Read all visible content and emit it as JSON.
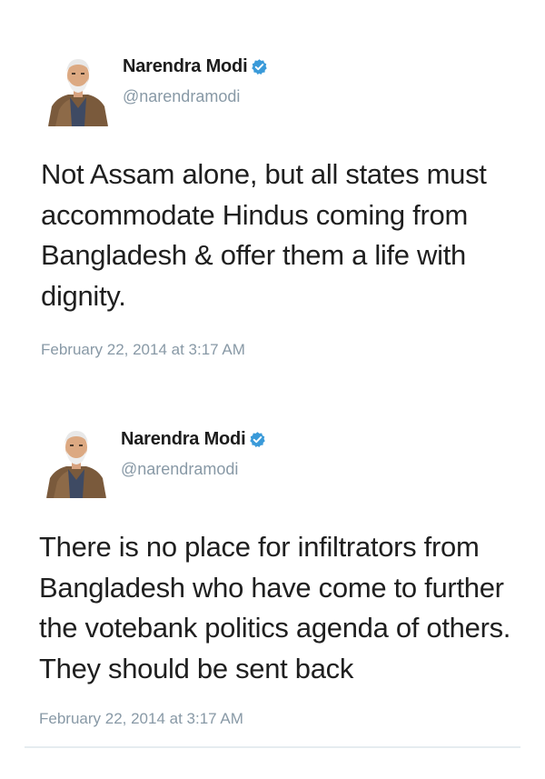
{
  "tweets": [
    {
      "display_name": "Narendra Modi",
      "handle": "@narendramodi",
      "verified": true,
      "text": "Not Assam alone, but all states must accommodate Hindus coming from Bangladesh & offer them a life with dignity.",
      "timestamp": "February 22, 2014 at 3:17 AM"
    },
    {
      "display_name": "Narendra Modi",
      "handle": "@narendramodi",
      "verified": true,
      "text": "There is no place for infiltrators from Bangladesh who have come to further the votebank politics agenda of others. They should be sent back",
      "timestamp": "February 22, 2014 at 3:17 AM"
    }
  ],
  "colors": {
    "verified_badge": "#3a9ad9",
    "secondary_text": "#8899a6",
    "primary_text": "#1f1f1f",
    "divider": "#e6ecf0"
  },
  "icons": {
    "avatar": "profile-photo",
    "verified": "verified-badge-icon"
  }
}
